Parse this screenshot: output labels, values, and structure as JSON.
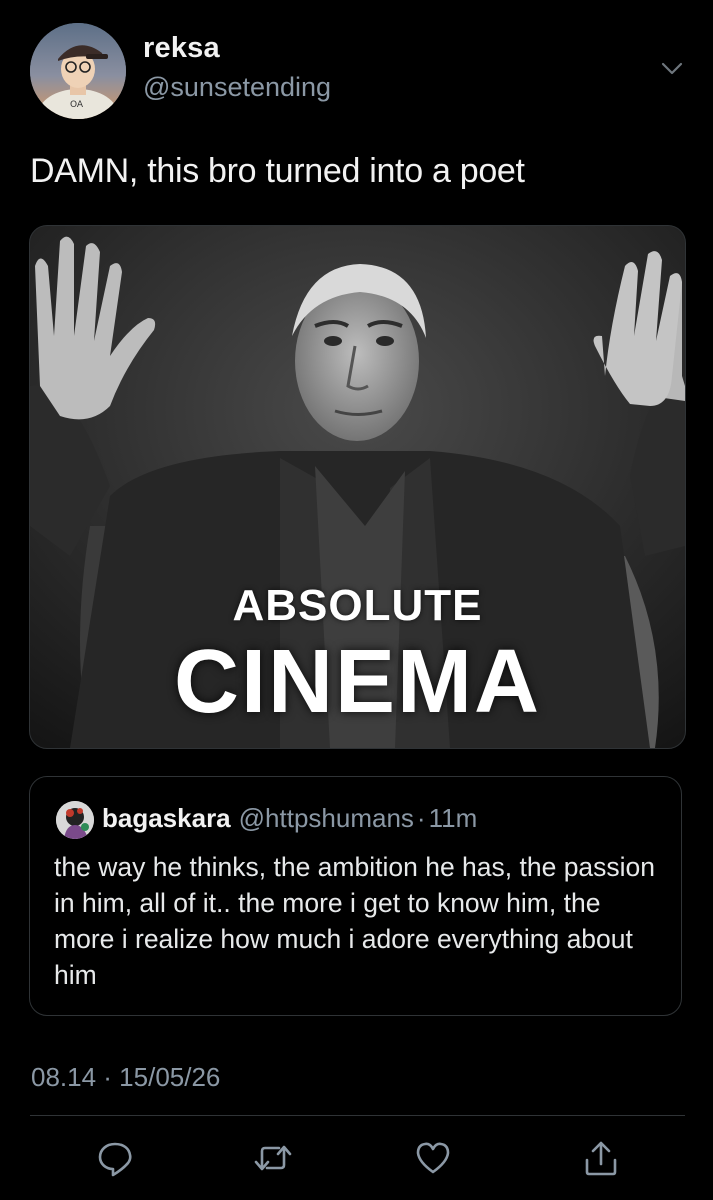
{
  "tweet": {
    "author": {
      "name": "reksa",
      "handle": "@sunsetending",
      "avatar_icon": "user-avatar"
    },
    "text": "DAMN, this bro turned into a poet",
    "media": {
      "caption_line1": "ABSOLUTE",
      "caption_line2": "CINEMA"
    },
    "quoted": {
      "name": "bagaskara",
      "handle": "@httpshumans",
      "separator": "·",
      "time": "11m",
      "text": "the way he thinks, the ambition he has, the passion in him, all of it.. the more i get to know him, the more i realize how much i adore everything about him"
    },
    "timestamp": "08.14 · 15/05/26"
  },
  "actions": {
    "icons": [
      "reply-icon",
      "retweet-icon",
      "like-icon",
      "share-icon"
    ],
    "color": "#8b98a5"
  },
  "colors": {
    "background": "#000000",
    "text": "#e7e9ea",
    "secondary": "#8b98a5",
    "border": "#2f3336"
  }
}
